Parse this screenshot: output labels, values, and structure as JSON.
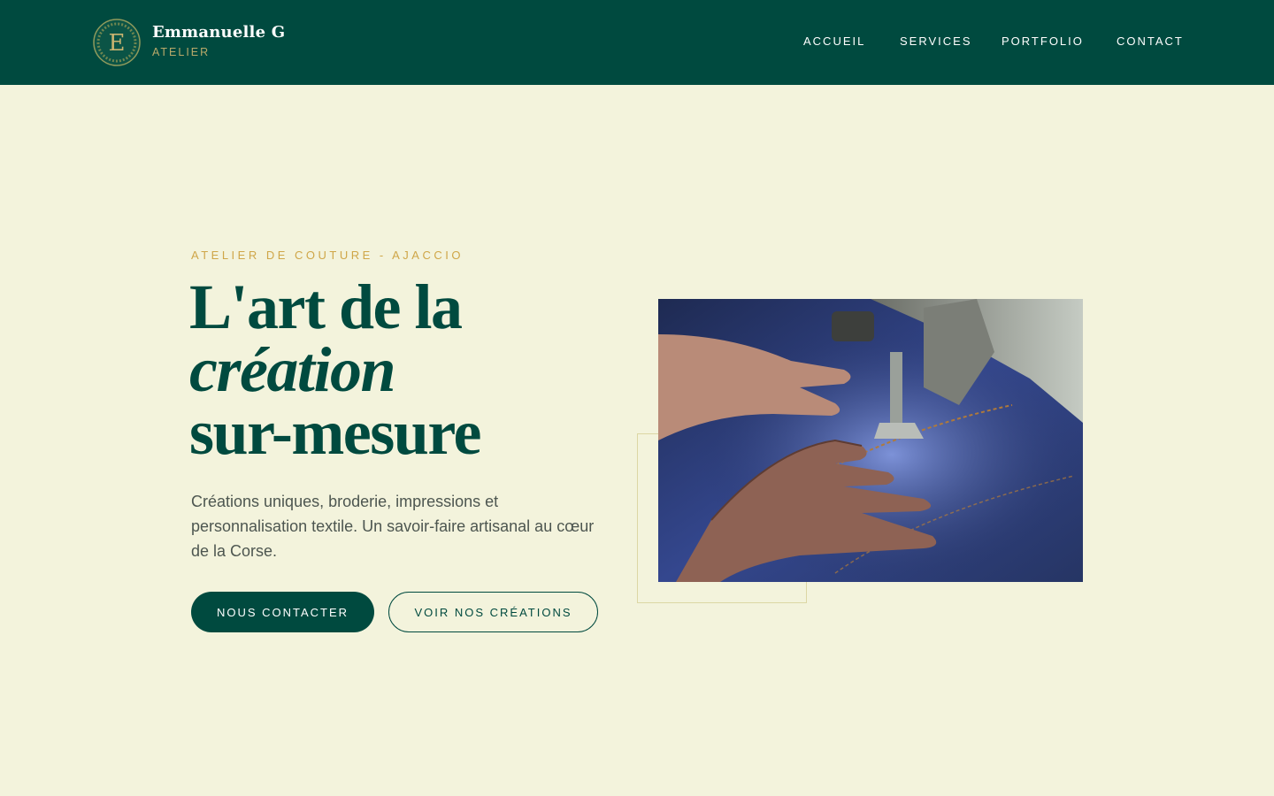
{
  "header": {
    "brand_name": "Emmanuelle G",
    "brand_sub": "ATELIER",
    "logo_letter": "E",
    "nav": [
      "ACCUEIL",
      "SERVICES",
      "PORTFOLIO",
      "CONTACT"
    ]
  },
  "hero": {
    "eyebrow": "ATELIER DE COUTURE - AJACCIO",
    "headline_line1": "L'art de la",
    "headline_line2": "création",
    "headline_line3": "sur-mesure",
    "lead": "Créations uniques, broderie, impressions et personnalisation textile. Un savoir-faire artisanal au cœur de la Corse.",
    "primary_button": "NOUS CONTACTER",
    "secondary_button": "VOIR NOS CRÉATIONS"
  },
  "colors": {
    "header_bg": "#004a3f",
    "page_bg": "#f3f3dc",
    "accent_gold": "#cfa648",
    "text_muted": "#4d5650"
  },
  "icons": {
    "logo": "monogram-e-wreath-icon"
  }
}
